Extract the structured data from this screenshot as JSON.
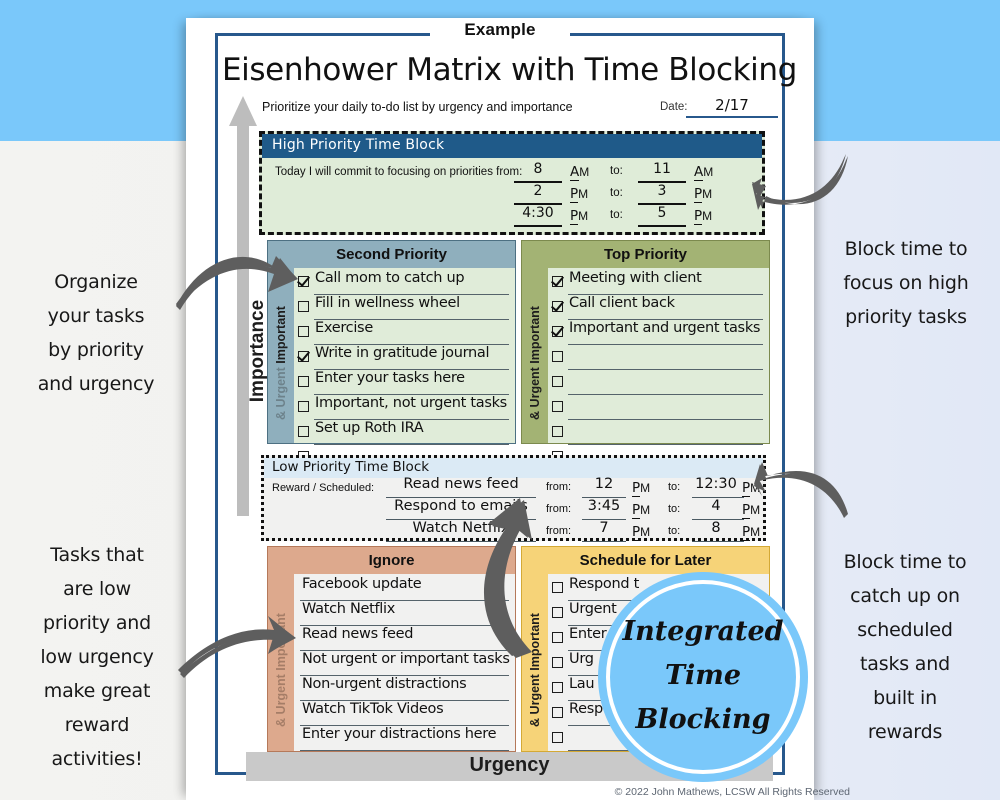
{
  "example_label": "Example",
  "title": "Eisenhower Matrix with Time Blocking",
  "subtitle": "Prioritize your daily to-do list by urgency and importance",
  "date": {
    "label": "Date:",
    "value": "2/17"
  },
  "axes": {
    "vertical": "Importance",
    "horizontal": "Urgency"
  },
  "copyright": "© 2022 John Mathews, LCSW  All Rights Reserved",
  "high_priority_block": {
    "header": "High Priority Time Block",
    "sentence": "Today I will commit to focusing on priorities from:",
    "to_label": "to:",
    "rows": [
      {
        "from_time": "8",
        "from_ampm": "A",
        "to_time": "11",
        "to_ampm": "A"
      },
      {
        "from_time": "2",
        "from_ampm": "P",
        "to_time": "3",
        "to_ampm": "P"
      },
      {
        "from_time": "4:30",
        "from_ampm": "P",
        "to_time": "5",
        "to_ampm": "P"
      }
    ]
  },
  "low_priority_block": {
    "header": "Low Priority Time Block",
    "reward_label": "Reward / Scheduled:",
    "from_label": "from:",
    "to_label": "to:",
    "rows": [
      {
        "task": "Read news feed",
        "from_time": "12",
        "from_ampm": "P",
        "to_time": "12:30",
        "to_ampm": "P"
      },
      {
        "task": "Respond to emails",
        "from_time": "3:45",
        "from_ampm": "P",
        "to_time": "4",
        "to_ampm": "P"
      },
      {
        "task": "Watch Netflix",
        "from_time": "7",
        "from_ampm": "P",
        "to_time": "8",
        "to_ampm": "P"
      }
    ]
  },
  "quadrants": {
    "second_priority": {
      "title": "Second Priority",
      "side_strong": "Important",
      "side_faded": "& Urgent",
      "tasks": [
        {
          "text": "Call mom to catch up",
          "checked": true
        },
        {
          "text": "Fill in wellness wheel",
          "checked": false
        },
        {
          "text": "Exercise",
          "checked": false
        },
        {
          "text": "Write in gratitude journal",
          "checked": true
        },
        {
          "text": "Enter your tasks here",
          "checked": false
        },
        {
          "text": "Important, not urgent tasks",
          "checked": false
        },
        {
          "text": "Set up Roth IRA",
          "checked": false
        },
        {
          "text": "",
          "checked": false
        }
      ]
    },
    "top_priority": {
      "title": "Top Priority",
      "side_strong": "Important",
      "side_faded": "& Urgent",
      "tasks": [
        {
          "text": "Meeting with client",
          "checked": true
        },
        {
          "text": "Call client back",
          "checked": true
        },
        {
          "text": "Important and urgent tasks",
          "checked": true
        },
        {
          "text": "",
          "checked": false
        },
        {
          "text": "",
          "checked": false
        },
        {
          "text": "",
          "checked": false
        },
        {
          "text": "",
          "checked": false
        },
        {
          "text": "",
          "checked": false
        }
      ]
    },
    "ignore": {
      "title": "Ignore",
      "side_strong": "Important",
      "side_faded": "& Urgent",
      "tasks": [
        {
          "text": "Facebook update"
        },
        {
          "text": "Watch Netflix"
        },
        {
          "text": "Read news feed"
        },
        {
          "text": "Not urgent or important tasks"
        },
        {
          "text": "Non-urgent distractions"
        },
        {
          "text": "Watch TikTok Videos"
        },
        {
          "text": "Enter your distractions here"
        }
      ]
    },
    "schedule_for_later": {
      "title": "Schedule for Later",
      "side_strong": "Important",
      "side_faded": "& Urgent",
      "tasks": [
        {
          "text": "Respond t",
          "checked": false
        },
        {
          "text": "Urgent",
          "checked": false
        },
        {
          "text": "Enter",
          "checked": false
        },
        {
          "text": "Urg",
          "checked": false
        },
        {
          "text": "Lau",
          "checked": false
        },
        {
          "text": "Resp",
          "checked": false
        },
        {
          "text": "",
          "checked": false
        },
        {
          "text": "",
          "checked": false
        }
      ]
    }
  },
  "annotations": {
    "top_left": "Organize\nyour tasks\nby priority\nand urgency",
    "bottom_left": "Tasks that\nare low\npriority and\nlow urgency\nmake great\nreward\nactivities!",
    "top_right": "Block time to\nfocus on high\npriority tasks",
    "bottom_right": "Block time to\ncatch up on\nscheduled\ntasks and\nbuilt in\nrewards"
  },
  "badge": {
    "line1": "Integrated",
    "line2": "Time",
    "line3": "Blocking"
  },
  "colors": {
    "banner_blue": "#7ac8fa",
    "sheet_border": "#27588c",
    "high_priority_header": "#1f5a89",
    "high_priority_body": "#dfecd8",
    "second_priority": "#8fafbd",
    "top_priority": "#a3b374",
    "ignore": "#dda98d",
    "schedule_later": "#f6d378",
    "low_priority_header": "#dbeaf5",
    "arrow_gray": "#5e5e5e"
  }
}
